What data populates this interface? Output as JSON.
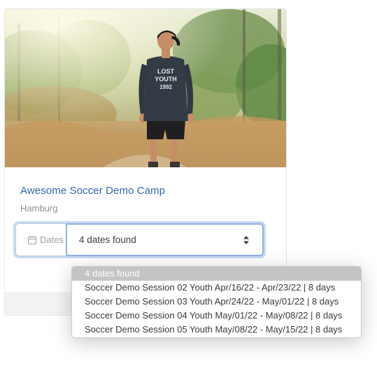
{
  "card": {
    "image_alt": "Young man in a LOST YOUTH 1992 sweatshirt standing on a sunny path",
    "shirt_text_line1": "LOST",
    "shirt_text_line2": "YOUTH",
    "shirt_text_line3": "1992",
    "title": "Awesome Soccer Demo Camp",
    "location": "Hamburg"
  },
  "dates_field": {
    "addon_label": "Dates",
    "addon_icon": "calendar-icon",
    "selected_value": "4 dates found",
    "arrows_icon": "sort-arrows-icon"
  },
  "dropdown": {
    "options": [
      "4 dates found",
      "Soccer Demo Session 02 Youth Apr/16/22 - Apr/23/22 | 8 days",
      "Soccer Demo Session 03 Youth Apr/24/22 - May/01/22 | 8 days",
      "Soccer Demo Session 04 Youth May/01/22 - May/08/22 | 8 days",
      "Soccer Demo Session 05 Youth May/08/22 - May/15/22 | 8 days"
    ],
    "selected_index": 0
  },
  "colors": {
    "title_link": "#2f66b0",
    "focus_ring": "#c7d9f4",
    "selected_option_bg": "#c4c4c4"
  }
}
